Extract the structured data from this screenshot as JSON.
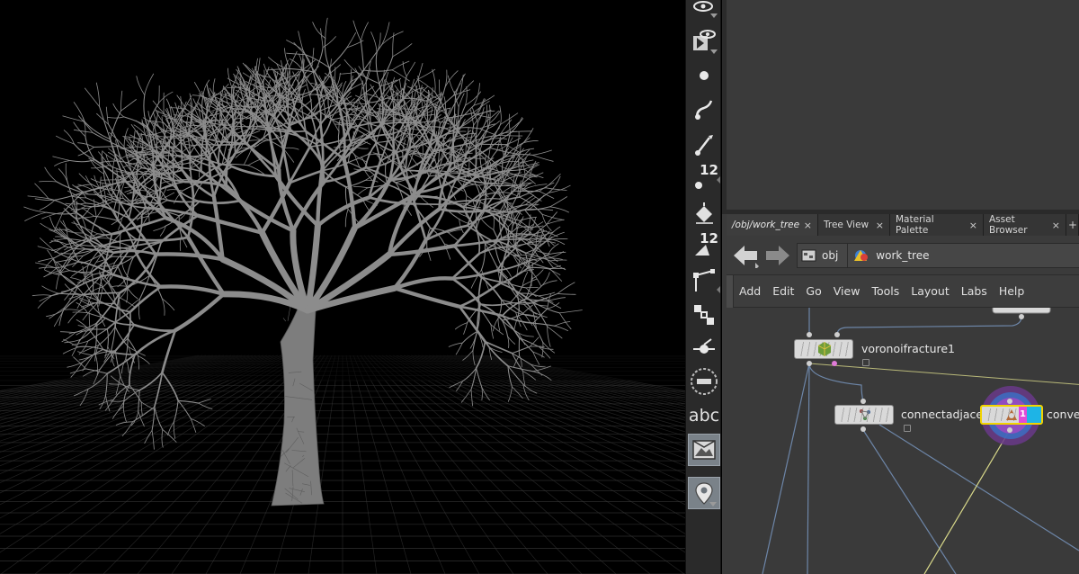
{
  "viewport": {
    "background": "#000000",
    "grid_color": "#3a3a3a",
    "tree_color": "#8c8c8c"
  },
  "toolbar": {
    "tools": [
      {
        "name": "visibility-icon"
      },
      {
        "name": "display-options-icon"
      },
      {
        "name": "point-icon"
      },
      {
        "name": "curve-icon"
      },
      {
        "name": "brush-icon"
      },
      {
        "name": "point-number-icon",
        "number": "12"
      },
      {
        "name": "paint-bucket-icon"
      },
      {
        "name": "prim-number-icon",
        "number": "12"
      },
      {
        "name": "polyline-icon"
      },
      {
        "name": "transform-handle-icon"
      },
      {
        "name": "pivot-icon"
      },
      {
        "name": "sphere-icon"
      },
      {
        "name": "text-tool-icon",
        "label": "abc"
      },
      {
        "name": "background-image-icon"
      },
      {
        "name": "location-pin-icon"
      }
    ]
  },
  "tabs": [
    {
      "label": "/obj/work_tree",
      "close": "×"
    },
    {
      "label": "Tree View",
      "close": "×"
    },
    {
      "label": "Material Palette",
      "close": "×"
    },
    {
      "label": "Asset Browser",
      "close": "×"
    }
  ],
  "path": {
    "root": "obj",
    "current": "work_tree"
  },
  "menu": [
    "Add",
    "Edit",
    "Go",
    "View",
    "Tools",
    "Layout",
    "Labs",
    "Help"
  ],
  "nodes": {
    "voronoi": {
      "label": "voronoifracture1"
    },
    "connect": {
      "label": "connectadjace"
    },
    "convex": {
      "label": "conve",
      "badge": "1"
    }
  },
  "colors": {
    "wire_blue": "#6d86a8",
    "wire_yellow": "#d9d98a",
    "selected_outline": "#f2d400",
    "accent_cyan": "#1eb4e6",
    "accent_magenta": "#e04ad8"
  }
}
